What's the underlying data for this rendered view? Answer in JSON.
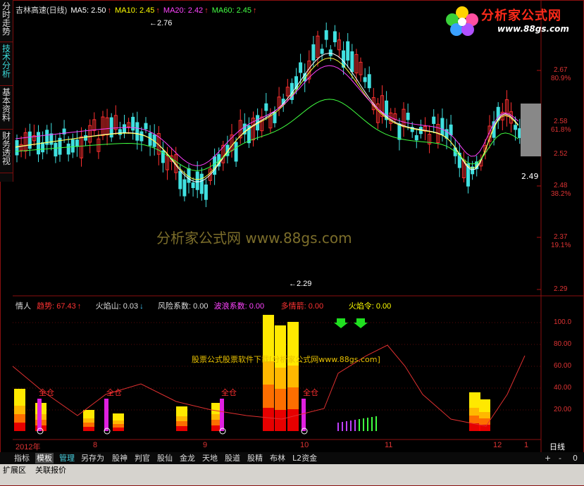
{
  "side_tabs": [
    {
      "label": "分时走势",
      "active": false
    },
    {
      "label": "技术分析",
      "active": true
    },
    {
      "label": "基本资料",
      "active": false
    },
    {
      "label": "财务透视",
      "active": false
    }
  ],
  "main_legend": {
    "title": "吉林高速(日线)",
    "ma5": "MA5: 2.50",
    "ma10": "MA10: 2.45",
    "ma20": "MA20: 2.42",
    "ma60": "MA60: 2.45"
  },
  "price_axis": [
    "2.67",
    "80.9%",
    "2.58",
    "61.8%",
    "2.52",
    "2.48",
    "38.2%",
    "2.37",
    "19.1%",
    "2.29"
  ],
  "annotations": {
    "high": "2.76",
    "low": "2.29",
    "last": "2.49"
  },
  "sub_legend": {
    "name": "情人",
    "trend": "趋势: 67.43",
    "flame": "火焰山: 0.03",
    "risk": "风险系数: 0.00",
    "wave": "波浪系数: 0.00",
    "bull": "多情箭: 0.00",
    "flame_order": "火焰令: 0.00"
  },
  "sub_axis": [
    "100.0",
    "80.00",
    "60.00",
    "40.00",
    "20.00"
  ],
  "full_position_label": "全仓",
  "watermark_main": "分析家公式网 www.88gs.com",
  "watermark_sub": "股票公式股票软件下载[分析家公式网www.88gs.com]",
  "logo": {
    "text": "分析家公式网",
    "url": "www.88gs.com"
  },
  "date_axis": [
    "2012年",
    "8",
    "9",
    "10",
    "11",
    "12",
    "1"
  ],
  "period": "日线",
  "toolbar": [
    "指标",
    "模板",
    "管理",
    "另存为",
    "股神",
    "判官",
    "股仙",
    "金龙",
    "天地",
    "股道",
    "股精",
    "布林",
    "L2资金"
  ],
  "zoom_controls": [
    "+",
    "-",
    "0"
  ],
  "status_items": [
    "扩展区",
    "关联报价"
  ],
  "colors": {
    "up": "#ff3030",
    "down": "#40e0e0",
    "ma5": "#ffffff",
    "ma10": "#ffff40",
    "ma20": "#ff40ff",
    "ma60": "#40ff40",
    "border": "#8a1010"
  }
}
